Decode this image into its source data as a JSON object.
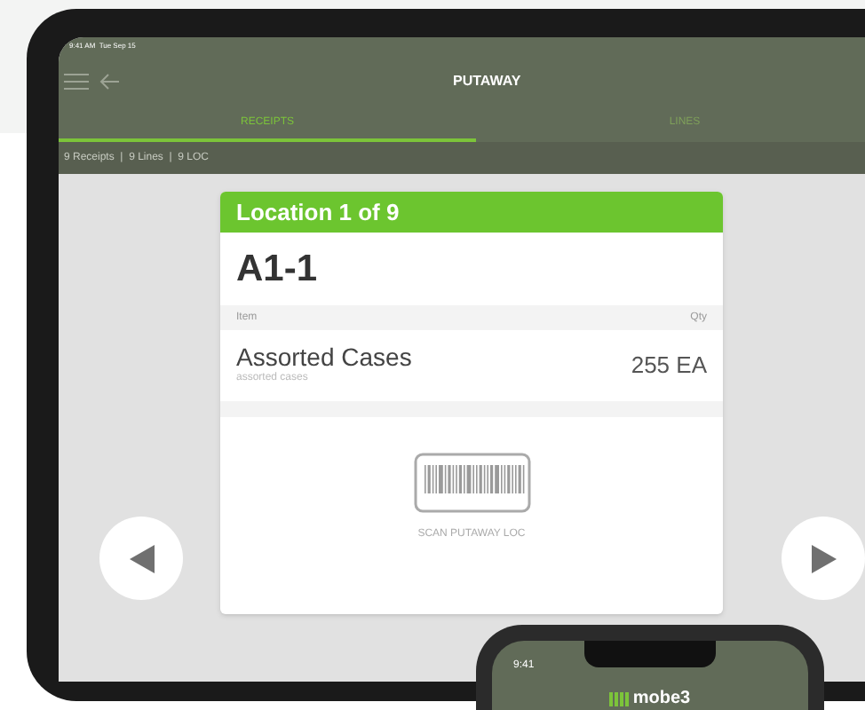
{
  "status_bar": {
    "time": "9:41 AM  Tue Sep 15"
  },
  "header": {
    "title": "PUTAWAY"
  },
  "tabs": [
    {
      "label": "RECEIPTS",
      "selected": true
    },
    {
      "label": "LINES",
      "selected": false
    }
  ],
  "summary": "9 Receipts  |  9 Lines  |  9 LOC",
  "card": {
    "header": "Location 1 of 9",
    "location": "A1-1",
    "columns": [
      "Item",
      "Qty"
    ],
    "item": "Assorted Cases",
    "item_sub": "assorted cases",
    "qty": "255 EA",
    "scan_label": "SCAN PUTAWAY LOC"
  },
  "phone": {
    "time": "9:41",
    "brand": "mobe3"
  }
}
